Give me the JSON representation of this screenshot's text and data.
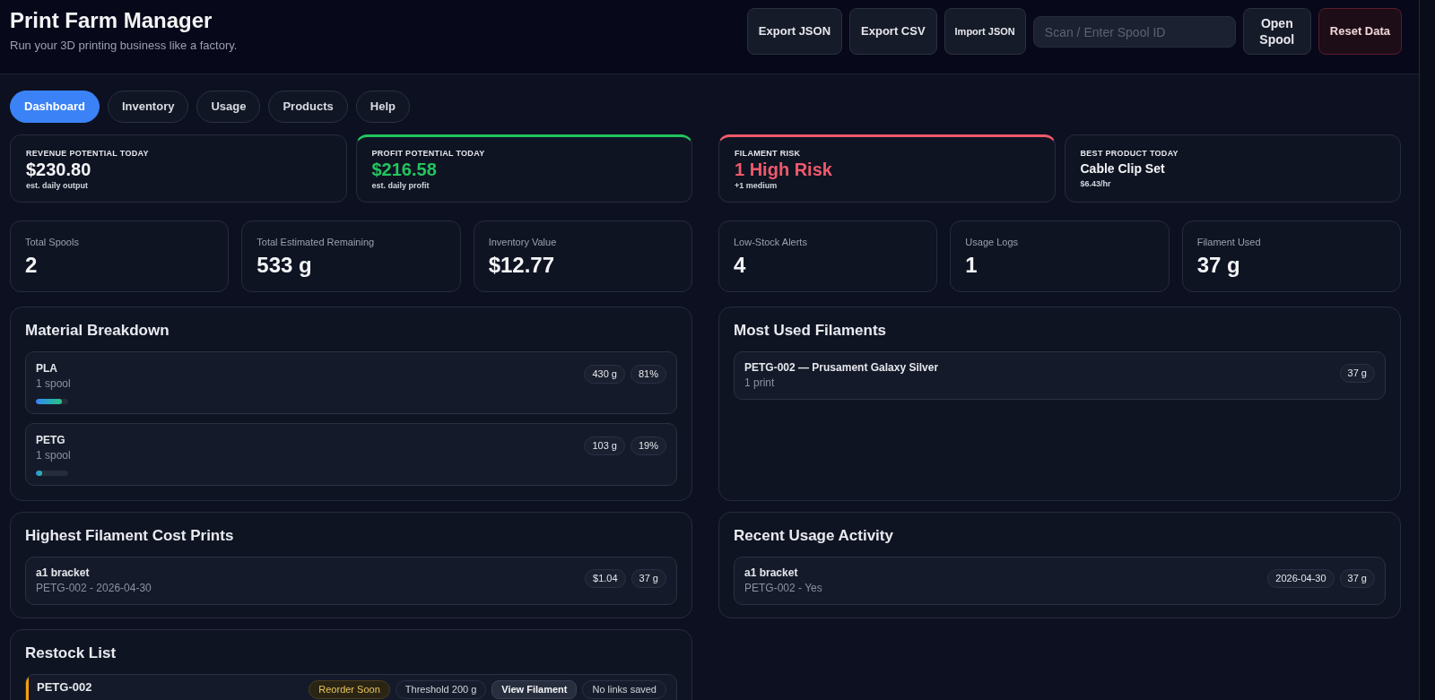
{
  "header": {
    "title": "Print Farm Manager",
    "subtitle": "Run your 3D printing business like a factory.",
    "actions": [
      {
        "kind": "button",
        "label": "Export JSON"
      },
      {
        "kind": "button",
        "label": "Export CSV"
      },
      {
        "kind": "small_button",
        "label": "Import JSON"
      },
      {
        "kind": "field",
        "placeholder": "Scan / Enter Spool ID"
      },
      {
        "kind": "narrow_button",
        "label": "Open Spool"
      },
      {
        "kind": "danger_button",
        "label": "Reset Data"
      }
    ]
  },
  "tabs": [
    {
      "label": "Dashboard",
      "selected": true
    },
    {
      "label": "Inventory",
      "selected": false
    },
    {
      "label": "Usage",
      "selected": false
    },
    {
      "label": "Products",
      "selected": false
    },
    {
      "label": "Help",
      "selected": false
    }
  ],
  "highlights": [
    {
      "kind": "metric",
      "label": "REVENUE POTENTIAL TODAY",
      "value": "$230.80",
      "note": "est. daily output"
    },
    {
      "kind": "metric",
      "label": "PROFIT POTENTIAL TODAY",
      "value": "$216.58",
      "note": "est. daily profit",
      "color": "#22c55e"
    },
    {
      "kind": "metric",
      "label": "FILAMENT RISK",
      "value": "1 High Risk",
      "note": "+1 medium",
      "color": "#ef5a6a"
    },
    {
      "kind": "title",
      "label": "BEST PRODUCT TODAY",
      "value": "Cable Clip Set",
      "note": "$6.43/hr"
    }
  ],
  "stats": [
    {
      "label": "Total Spools",
      "value": "2"
    },
    {
      "label": "Total Estimated Remaining",
      "value": "533 g"
    },
    {
      "label": "Inventory Value",
      "value": "$12.77"
    },
    {
      "label": "Low-Stock Alerts",
      "value": "4"
    },
    {
      "label": "Usage Logs",
      "value": "1"
    },
    {
      "label": "Filament Used",
      "value": "37 g"
    }
  ],
  "material_breakdown": {
    "title": "Material Breakdown",
    "items": [
      {
        "name": "PLA",
        "note": "1 spool",
        "weight": "430 g",
        "share": "81%",
        "level": 0.81
      },
      {
        "name": "PETG",
        "note": "1 spool",
        "weight": "103 g",
        "share": "19%",
        "level": 0.19
      }
    ]
  },
  "most_used_filaments": {
    "title": "Most Used Filaments",
    "items": [
      {
        "name": "PETG-002 — Prusament Galaxy Silver",
        "note": "1 print",
        "badges": [
          "37 g"
        ]
      }
    ]
  },
  "highest_cost_prints": {
    "title": "Highest Filament Cost Prints",
    "items": [
      {
        "name": "a1 bracket",
        "note": "PETG-002 - 2026-04-30",
        "badges": [
          "$1.04",
          "37 g"
        ]
      }
    ]
  },
  "recent_usage": {
    "title": "Recent Usage Activity",
    "items": [
      {
        "name": "a1 bracket",
        "note": "PETG-002 - Yes",
        "badges": [
          "2026-04-30",
          "37 g"
        ]
      }
    ]
  },
  "restock_list": {
    "title": "Restock List",
    "items": [
      {
        "name": "PETG-002",
        "color": "#f59e0b",
        "tags": [
          {
            "kind": "warning",
            "label": "Reorder Soon"
          },
          {
            "kind": "info",
            "label": "Threshold 200 g"
          },
          {
            "kind": "button",
            "label": "View Filament"
          },
          {
            "kind": "info",
            "label": "No links saved"
          }
        ]
      }
    ]
  }
}
